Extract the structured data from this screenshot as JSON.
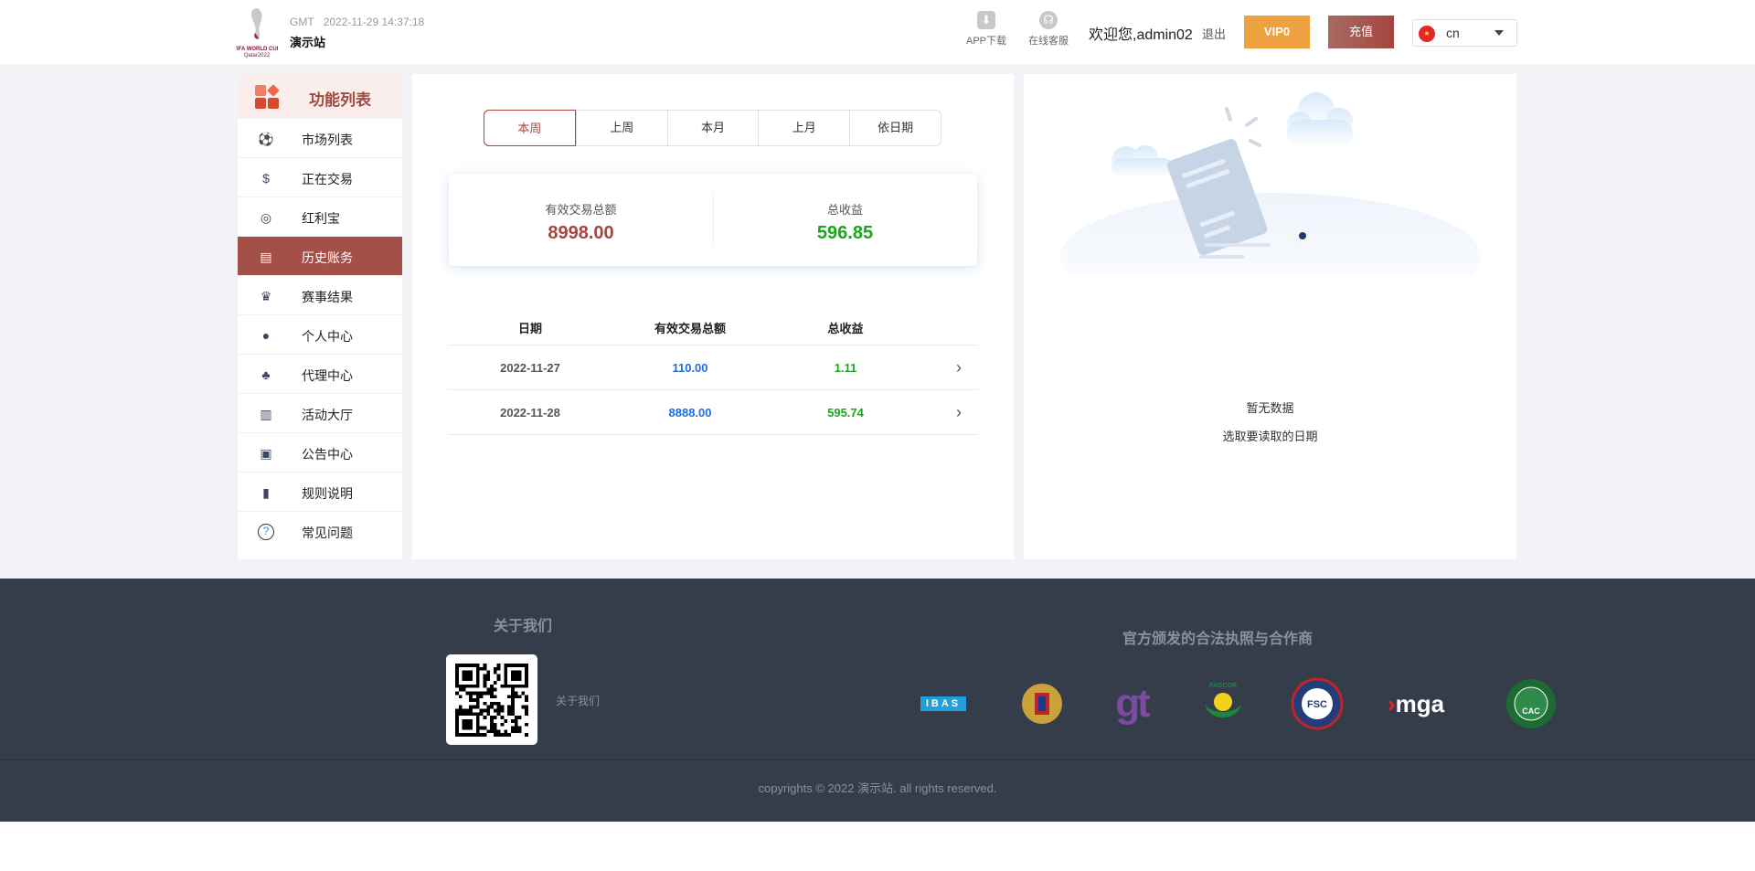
{
  "header": {
    "logo_text": "FIFA WORLD CUP Qatar2022",
    "timezone": "GMT",
    "datetime": "2022-11-29 14:37:18",
    "site_name": "演示站",
    "app_download": "APP下载",
    "support": "在线客服",
    "welcome": "欢迎您,admin02",
    "logout": "退出",
    "vip": "VIP0",
    "recharge": "充值",
    "language": "cn"
  },
  "sidebar": {
    "title": "功能列表",
    "items": [
      {
        "label": "市场列表",
        "icon": "soccer-ball-icon"
      },
      {
        "label": "正在交易",
        "icon": "dollar-card-icon"
      },
      {
        "label": "红利宝",
        "icon": "coins-icon"
      },
      {
        "label": "历史账务",
        "icon": "bill-icon",
        "active": true
      },
      {
        "label": "赛事结果",
        "icon": "trophy-icon"
      },
      {
        "label": "个人中心",
        "icon": "user-gear-icon"
      },
      {
        "label": "代理中心",
        "icon": "org-chart-icon"
      },
      {
        "label": "活动大厅",
        "icon": "gift-icon"
      },
      {
        "label": "公告中心",
        "icon": "megaphone-icon"
      },
      {
        "label": "规则说明",
        "icon": "book-icon"
      },
      {
        "label": "常见问题",
        "icon": "question-icon"
      }
    ]
  },
  "main": {
    "tabs": [
      "本周",
      "上周",
      "本月",
      "上月",
      "依日期"
    ],
    "summary": {
      "turnover_label": "有效交易总额",
      "turnover": "8998.00",
      "profit_label": "总收益",
      "profit": "596.85"
    },
    "table": {
      "headers": [
        "日期",
        "有效交易总额",
        "总收益"
      ],
      "rows": [
        {
          "date": "2022-11-27",
          "turnover": "110.00",
          "profit": "1.11"
        },
        {
          "date": "2022-11-28",
          "turnover": "8888.00",
          "profit": "595.74"
        }
      ]
    }
  },
  "detail": {
    "empty_title": "暂无数据",
    "empty_hint": "选取要读取的日期"
  },
  "footer": {
    "about_title": "关于我们",
    "about_link": "关于我们",
    "license_title": "官方颁发的合法执照与合作商",
    "licenses": [
      "IBAS",
      "UK Gambling",
      "gt",
      "PAGCOR",
      "FSC",
      "mga",
      "CAC"
    ],
    "copyright": "copyrights © 2022 演示站. all rights reserved."
  },
  "colors": {
    "accent": "#a3463e",
    "vip": "#eea23f",
    "profit": "#18a818",
    "turnover": "#1f6fe0",
    "footer": "#353d4a"
  }
}
